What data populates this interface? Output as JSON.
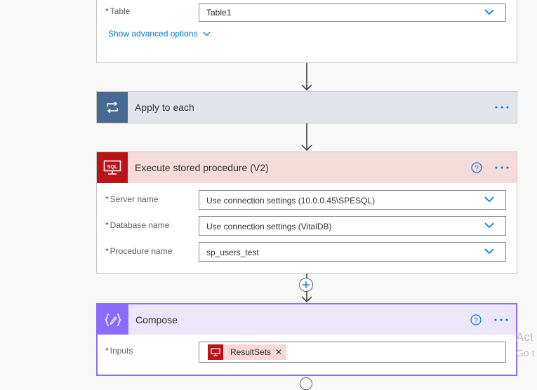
{
  "table_card": {
    "label": "Table",
    "value": "Table1",
    "advanced": "Show advanced options"
  },
  "apply_card": {
    "title": "Apply to each"
  },
  "sql_card": {
    "title": "Execute stored procedure (V2)",
    "icon_text": "SQL",
    "fields": [
      {
        "label": "Server name",
        "value": "Use connection settings (10.0.0.45\\SPESQL)"
      },
      {
        "label": "Database name",
        "value": "Use connection settings (VitalDB)"
      },
      {
        "label": "Procedure name",
        "value": "sp_users_test"
      }
    ]
  },
  "compose_card": {
    "title": "Compose",
    "inputs_label": "Inputs",
    "token": "ResultSets"
  },
  "ghost": {
    "line1": "Act",
    "line2": "Go t"
  },
  "colors": {
    "apply_header": "#e1e5eb",
    "apply_icon_bg": "#486991",
    "sql_header": "#f6dbdb",
    "sql_icon_bg": "#ba141a",
    "compose_header": "#ece6fb",
    "compose_icon_bg": "#8c6cff",
    "accent": "#0078d4"
  }
}
